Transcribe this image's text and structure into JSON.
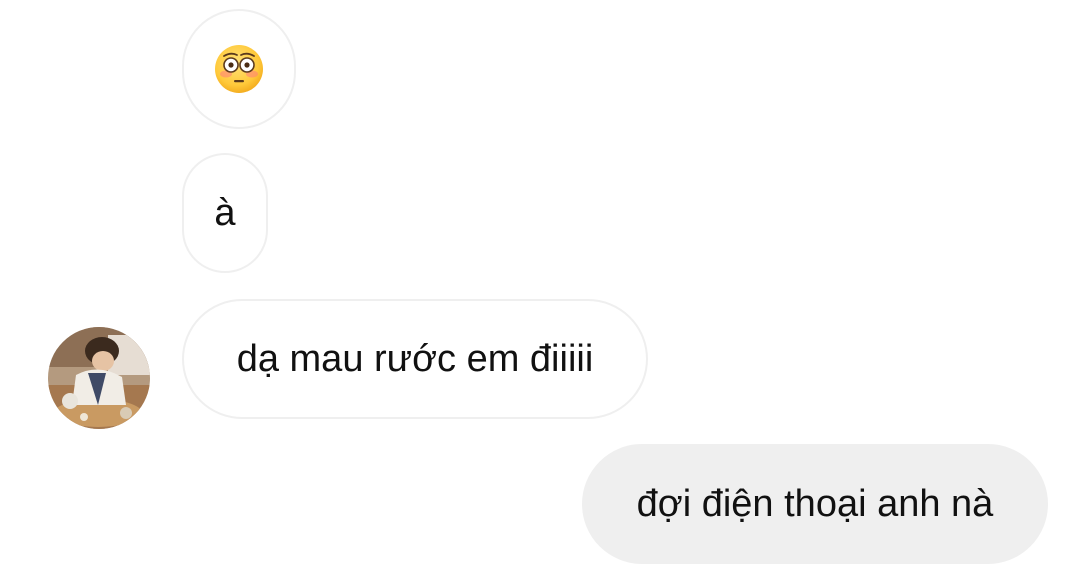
{
  "conversation": {
    "messages": [
      {
        "sender": "contact",
        "type": "emoji",
        "emoji_icon": "flushed-face-emoji",
        "text": "😳"
      },
      {
        "sender": "contact",
        "type": "text",
        "text": "à"
      },
      {
        "sender": "contact",
        "type": "text",
        "text": "dạ mau rước em điiiii"
      },
      {
        "sender": "me",
        "type": "text",
        "text": "đợi điện thoại anh nà"
      }
    ],
    "avatar_icon": "contact-avatar-photo"
  },
  "colors": {
    "background": "#ffffff",
    "incoming_border": "#efefef",
    "outgoing_bubble": "#efefef",
    "text": "#111111"
  }
}
